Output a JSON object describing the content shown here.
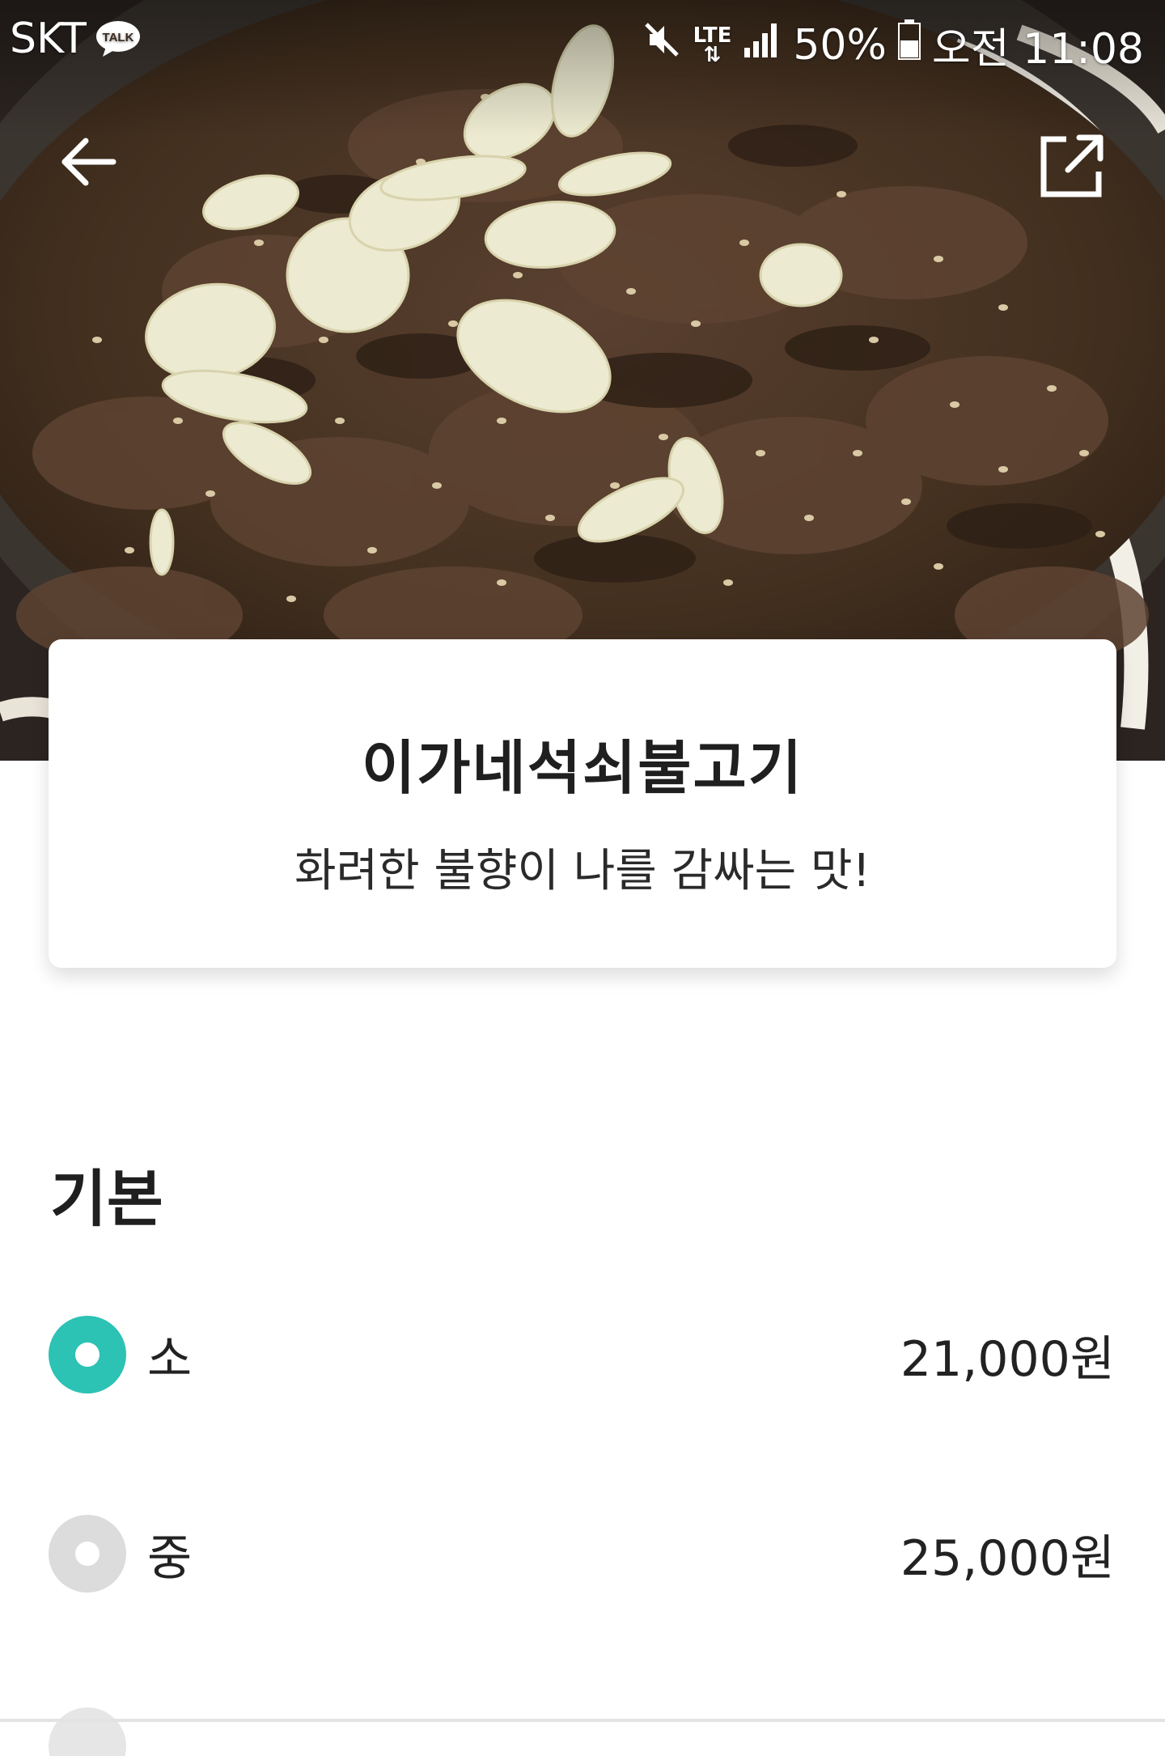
{
  "status_bar": {
    "carrier": "SKT",
    "talk_badge": "TALK",
    "network": "LTE",
    "battery": "50%",
    "time": "오전 11:08"
  },
  "nav": {
    "back_icon": "arrow-left-icon",
    "share_icon": "share-external-icon"
  },
  "menu": {
    "name": "이가네석쇠불고기",
    "description": "화려한 불향이 나를 감싸는 맛!"
  },
  "options": {
    "section_title": "기본",
    "items": [
      {
        "label": "소",
        "price": "21,000원",
        "selected": true
      },
      {
        "label": "중",
        "price": "25,000원",
        "selected": false
      }
    ]
  },
  "colors": {
    "accent": "#2cc2b4",
    "unselected": "#dcdcdc"
  }
}
